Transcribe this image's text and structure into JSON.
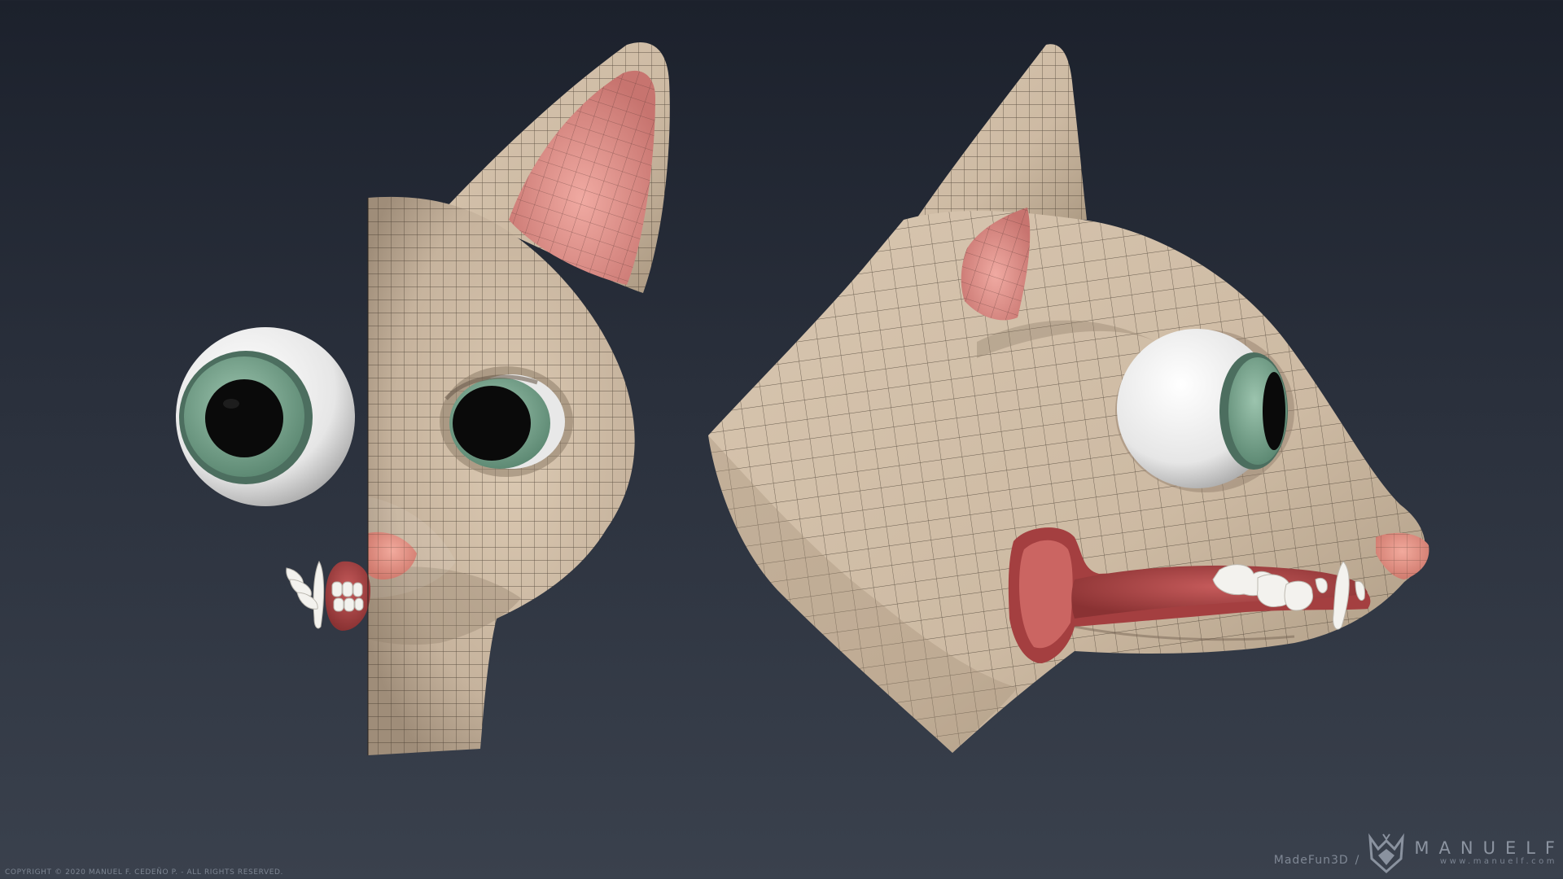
{
  "colors": {
    "background_top": "#1c212c",
    "background_bottom": "#3a414d",
    "skin": "#cdbba6",
    "wire": "#3d3328",
    "ear_inner": "#e59a92",
    "iris": "#7fa893",
    "pupil": "#0a0a0a",
    "gum": "#a94546",
    "tooth": "#f2f2ef"
  },
  "footer": {
    "copyright": "COPYRIGHT © 2020 MANUEL F. CEDEÑO P. - ALL RIGHTS RESERVED.",
    "madefun": "MadeFun3D",
    "slash": "/",
    "brand_name": "MANUELF",
    "brand_url": "www.manuelf.com"
  }
}
